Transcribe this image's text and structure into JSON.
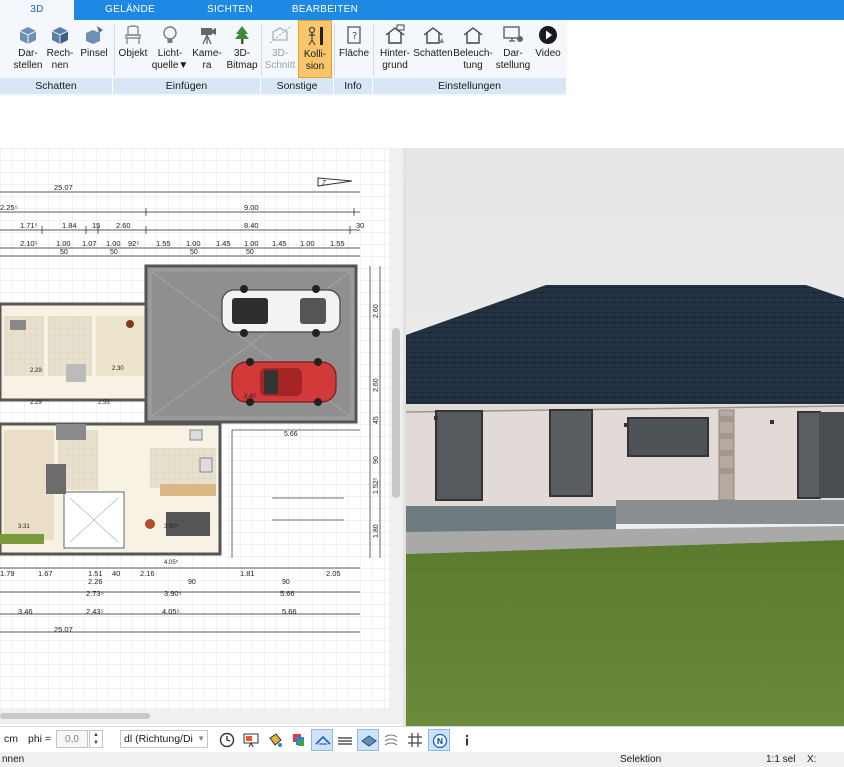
{
  "tabs": [
    {
      "label": "3D"
    },
    {
      "label": "GELÄNDE"
    },
    {
      "label": "SICHTEN"
    },
    {
      "label": "BEARBEITEN"
    }
  ],
  "ribbon": {
    "buttons": {
      "darstellen": {
        "l1": "Dar-",
        "l2": "stellen"
      },
      "rechnen": {
        "l1": "Rech-",
        "l2": "nen"
      },
      "pinsel": {
        "l1": "Pinsel",
        "l2": ""
      },
      "objekt": {
        "l1": "Objekt",
        "l2": ""
      },
      "lichtquelle": {
        "l1": "Licht-",
        "l2": "quelle"
      },
      "kamera": {
        "l1": "Kame-",
        "l2": "ra"
      },
      "bitmap": {
        "l1": "3D-",
        "l2": "Bitmap"
      },
      "schnitt": {
        "l1": "3D-",
        "l2": "Schnitt"
      },
      "kollision": {
        "l1": "Kolli-",
        "l2": "sion"
      },
      "flaeche": {
        "l1": "Fläche",
        "l2": ""
      },
      "hintergrund": {
        "l1": "Hinter-",
        "l2": "grund"
      },
      "schatten2": {
        "l1": "Schatten",
        "l2": ""
      },
      "beleuchtung": {
        "l1": "Beleuch-",
        "l2": "tung"
      },
      "darstellung": {
        "l1": "Dar-",
        "l2": "stellung"
      },
      "video": {
        "l1": "Video",
        "l2": ""
      }
    },
    "groups": {
      "schatten": "Schatten",
      "einfuegen": "Einfügen",
      "sonstige": "Sonstige",
      "info": "Info",
      "einstellungen": "Einstellungen"
    }
  },
  "plan": {
    "dims": {
      "total_top": "25.07",
      "total_bottom": "25.07",
      "d_225": "2.25⁵",
      "d_900": "9.00",
      "d_171": "1.71⁵",
      "d_184": "1.84",
      "d_15": "15",
      "d_260": "2.60",
      "d_840": "8.40",
      "d_30": "30",
      "d_210": "2.10⁵",
      "d_100a": "1.00",
      "d_107": "1.07",
      "d_100b": "1.00",
      "d_92": "92⁵",
      "d_155a": "1.55",
      "d_100c": "1.00",
      "d_145a": "1.45",
      "d_100d": "1.00",
      "d_145b": "1.45",
      "d_100e": "1.00",
      "d_155b": "1.55",
      "d_50a": "50",
      "d_50b": "50",
      "d_50c": "50",
      "d_50d": "50",
      "d_566a": "5.66",
      "d_566b": "5.66",
      "d_566c": "5.66",
      "d_179": "1.79",
      "d_167": "1.67",
      "d_151": "1.51",
      "d_40": "40",
      "d_216": "2.16",
      "d_181": "1.81",
      "d_205": "2.05",
      "d_226": "2.26",
      "d_90a": "90",
      "d_90b": "90",
      "d_273": "2.73⁵",
      "d_390": "3.90⁵",
      "d_346": "3.46",
      "d_243": "2.43⁵",
      "d_405": "4.05⁵",
      "d_229a": "2.29",
      "d_229b": "2.29",
      "d_230": "2.30",
      "d_255": "2.55",
      "d_331": "3.31",
      "d_340": "3.40",
      "d_405b": "4.05⁵",
      "d_390b": "3.90⁵",
      "v_260a": "2.60",
      "v_260b": "2.60",
      "v_90": "90",
      "v_152": "1.52⁵",
      "v_180": "1.80",
      "v_45": "45"
    }
  },
  "bottom_toolbar": {
    "unit": "cm",
    "phi_label": "phi =",
    "phi_value": "0,0",
    "direction_value": "dl (Richtung/Di",
    "icons": [
      "clock-icon",
      "presentation-icon",
      "paint-bucket-icon",
      "layers-color-icon",
      "roof-tool-icon",
      "roof-tiles-icon",
      "plane-icon",
      "contour-icon",
      "grid-icon",
      "north-icon",
      "info-icon"
    ]
  },
  "status": {
    "left": "nnen",
    "mode": "Selektion",
    "selection": "1:1 sel",
    "x_label": "X:"
  }
}
